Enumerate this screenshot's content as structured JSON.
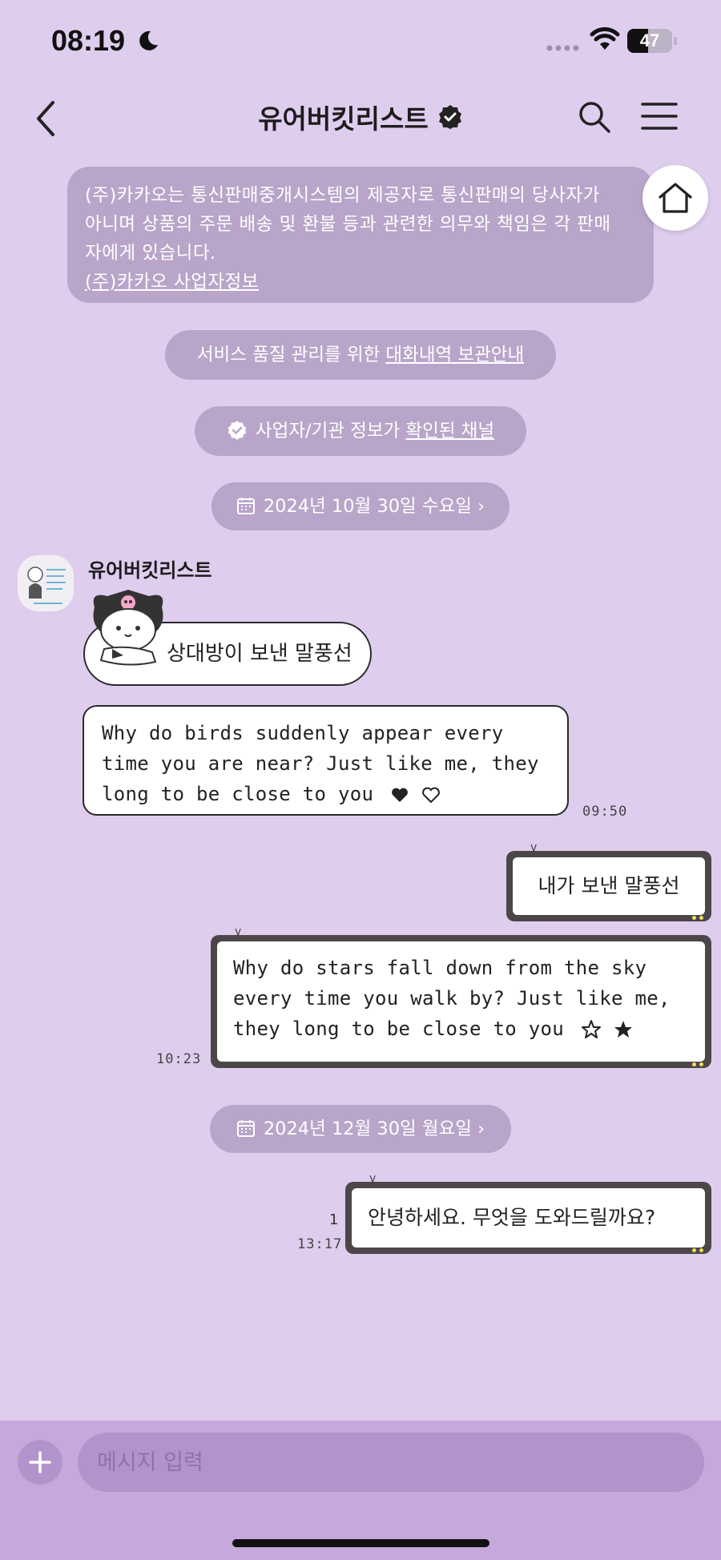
{
  "status_bar": {
    "time": "08:19",
    "battery_level": "47",
    "battery_fraction": 0.47
  },
  "header": {
    "title": "유어버킷리스트"
  },
  "notice": {
    "line1": "(주)카카오는 통신판매중개시스템의 제공자로 통신판매의 당사자가",
    "line2": "아니며 상품의 주문 배송 및 환불 등과 관련한 의무와 책임은 각 판매",
    "line3": "자에게 있습니다.",
    "link": "(주)카카오 사업자정보"
  },
  "service_notice": {
    "prefix": "서비스 품질 관리를 위한 ",
    "link": "대화내역 보관안내"
  },
  "verified_notice": {
    "prefix": "사업자/기관 정보가 ",
    "link": "확인된 채널"
  },
  "date_dividers": [
    "2024년 10월 30일 수요일",
    "2024년 12월 30일 월요일"
  ],
  "chat": {
    "sender_name": "유어버킷리스트",
    "incoming": {
      "sticker_text": "상대방이 보낸 말풍선",
      "text_line1": "Why do birds suddenly appear every",
      "text_line2": "time you are near? Just like me, they",
      "text_line3": "long to be close to you",
      "time": "09:50"
    },
    "outgoing": [
      {
        "text": "내가 보낸 말풍선"
      },
      {
        "line1": "Why do stars fall down from the sky",
        "line2": "every time you walk by? Just like me,",
        "line3": "they long to be close to you",
        "time": "10:23"
      },
      {
        "text": "안녕하세요. 무엇을 도와드릴까요?",
        "unread": "1",
        "time": "13:17"
      }
    ]
  },
  "input": {
    "placeholder": "메시지 입력"
  }
}
